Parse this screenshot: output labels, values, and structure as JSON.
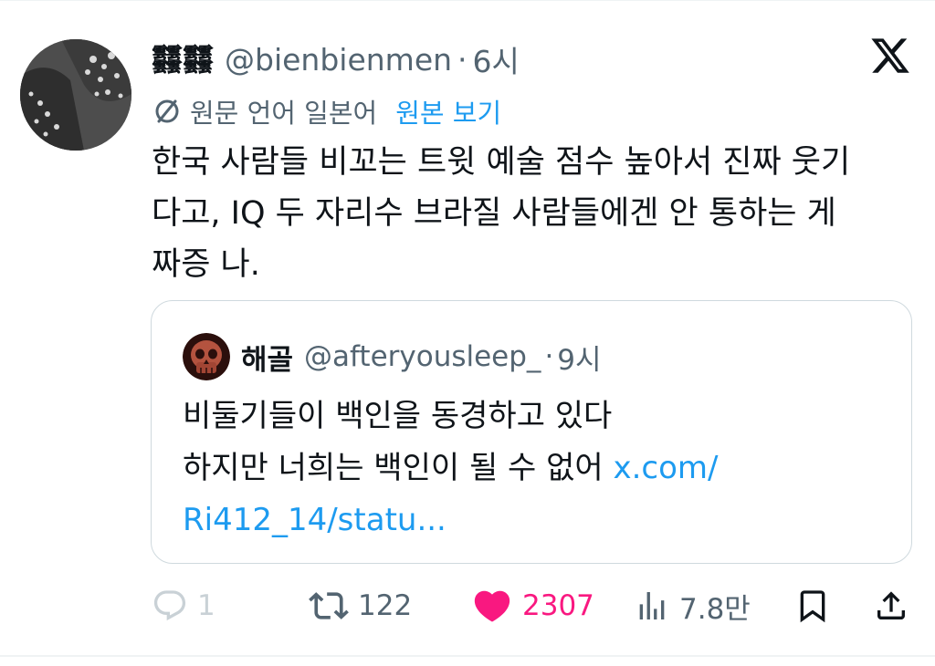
{
  "tweet": {
    "display_name": "𩇔𩇔",
    "handle": "@bienbienmen",
    "separator": "·",
    "time": "6시",
    "translation": {
      "label": "원문 언어 일본어",
      "show_original": "원본 보기"
    },
    "text": "한국 사람들 비꼬는 트윗 예술 점수 높아서 진짜 웃기\n다고, IQ 두 자리수 브라질 사람들에겐 안 통하는 게\n짜증 나."
  },
  "quote": {
    "display_name": "해골",
    "handle": "@afteryousleep_",
    "separator": "·",
    "time": "9시",
    "lines": [
      "비둘기들이 백인을 동경하고 있다",
      "하지만 너희는 백인이 될 수 없어 "
    ],
    "link_part1": "x.com/",
    "link_part2": "Ri412_14/statu..."
  },
  "actions": {
    "reply_count": "1",
    "retweet_count": "122",
    "like_count": "2307",
    "views_count": "7.8만"
  },
  "colors": {
    "accent": "#1d9bf0",
    "like": "#f91880",
    "muted": "#536471",
    "text": "#0f1419",
    "border": "#cfd9de"
  },
  "icons": [
    "x-logo-icon",
    "translate-icon",
    "reply-icon",
    "retweet-icon",
    "heart-icon",
    "views-icon",
    "bookmark-icon",
    "share-icon"
  ]
}
